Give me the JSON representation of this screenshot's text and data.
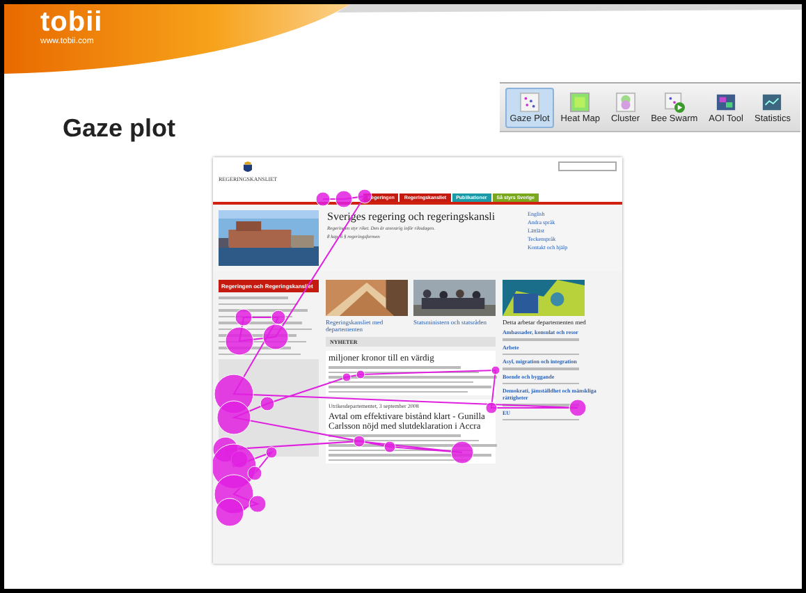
{
  "brand": {
    "logo": "tobii",
    "url": "www.tobii.com"
  },
  "title": "Gaze plot",
  "toolbar": [
    {
      "label": "Gaze Plot",
      "kind": "gaze",
      "selected": true
    },
    {
      "label": "Heat Map",
      "kind": "heat",
      "selected": false
    },
    {
      "label": "Cluster",
      "kind": "cluster",
      "selected": false
    },
    {
      "label": "Bee Swarm",
      "kind": "swarm",
      "selected": false
    },
    {
      "label": "AOI Tool",
      "kind": "aoi",
      "selected": false
    },
    {
      "label": "Statistics",
      "kind": "stats",
      "selected": false
    }
  ],
  "screenshot": {
    "site_name": "REGERINGSKANSLIET",
    "nav": [
      {
        "label": "Regeringen",
        "color": "#c41a10"
      },
      {
        "label": "Regeringskansliet",
        "color": "#c41a10"
      },
      {
        "label": "Publikationer",
        "color": "#1b9aa8"
      },
      {
        "label": "Så styrs Sverige",
        "color": "#7aa81c"
      }
    ],
    "heading": "Sveriges regering och regeringskansli",
    "quote": "Regeringen styr riket. Den är ansvarig inför riksdagen.",
    "citation": "8 kap. 6 § regeringsformen",
    "lang_links": [
      "English",
      "Andra språk",
      "Lättläst",
      "Teckenspråk"
    ],
    "contact": "Kontakt och hjälp",
    "sidebar_title": "Regeringen och Regeringskansliet",
    "cards": [
      "Regeringskansliet med departementen",
      "Statsministern och statsråden",
      "Detta arbetar departementen med"
    ],
    "news_heading": "NYHETER",
    "news": [
      {
        "title": "miljoner kronor till en värdig"
      },
      {
        "source": "Utrikesdepartementet, 3 september 2008",
        "title": "Avtal om effektivare bistånd klart - Gunilla Carlsson nöjd med slutdeklaration i Accra"
      }
    ],
    "topics": [
      "Ambassader, konsulat och resor",
      "Arbete",
      "Asyl, migration och integration",
      "Boende och byggande",
      "Demokrati, jämställdhet och mänskliga rättigheter",
      "EU"
    ]
  }
}
